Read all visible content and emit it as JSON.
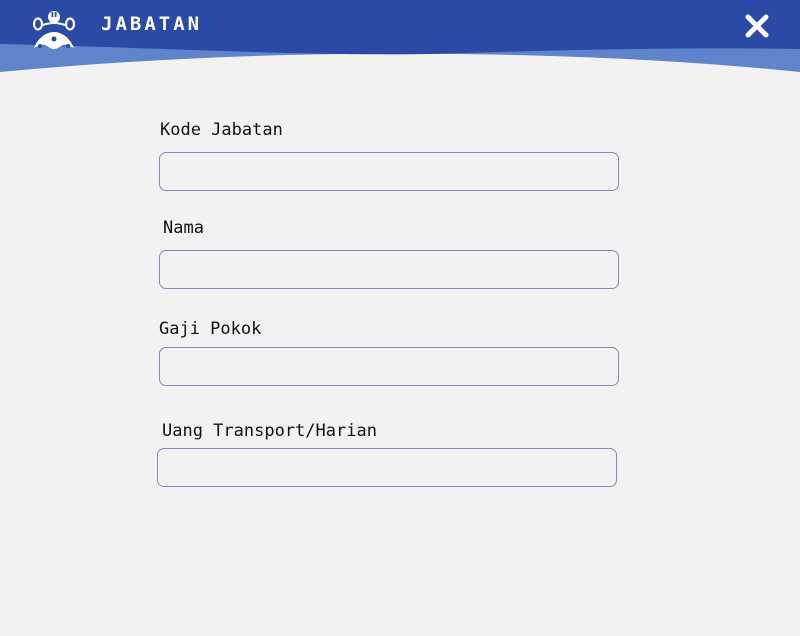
{
  "header": {
    "title": "JABATAN",
    "logo_icon": "stylized-people-logo-icon",
    "close_icon": "close-x-icon",
    "colors": {
      "primary": "#2b4aa6",
      "secondary": "#5f84cc",
      "text": "#ffffff"
    }
  },
  "form": {
    "fields": [
      {
        "label": "Kode Jabatan",
        "value": "",
        "placeholder": ""
      },
      {
        "label": "Nama",
        "value": "",
        "placeholder": ""
      },
      {
        "label": "Gaji Pokok",
        "value": "",
        "placeholder": ""
      },
      {
        "label": "Uang Transport/Harian",
        "value": "",
        "placeholder": ""
      }
    ]
  }
}
